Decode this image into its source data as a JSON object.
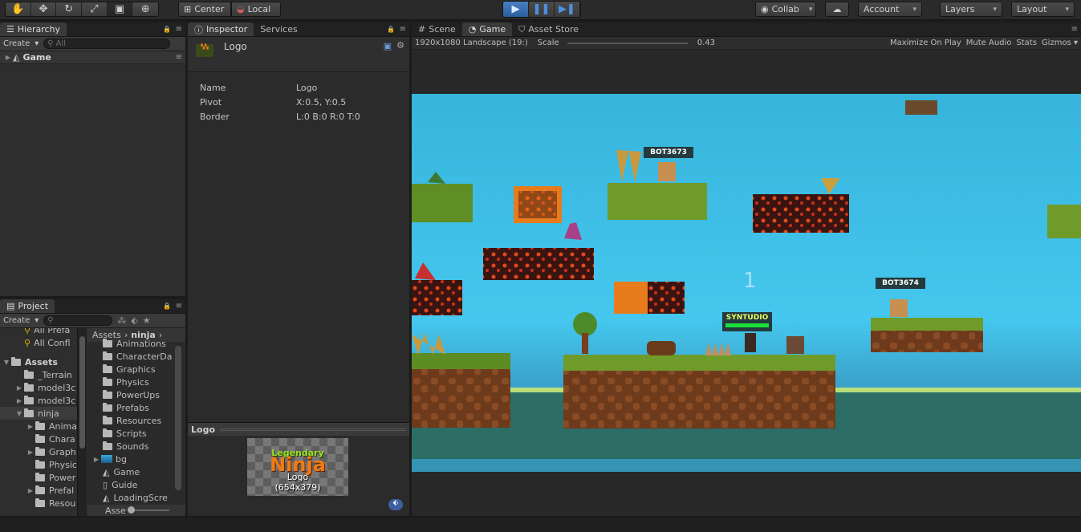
{
  "toolbar": {
    "tools": [
      "hand-tool-icon",
      "move-tool-icon",
      "rotate-tool-icon",
      "scale-tool-icon",
      "rect-tool-icon",
      "transform-tool-icon"
    ],
    "pivot_label": "Center",
    "space_label": "Local",
    "collab_label": "Collab",
    "account_label": "Account",
    "layers_label": "Layers",
    "layout_label": "Layout"
  },
  "hierarchy": {
    "tab": "Hierarchy",
    "create": "Create",
    "search_placeholder": "All",
    "scene_name": "Game"
  },
  "project": {
    "tab": "Project",
    "create": "Create",
    "favorites": [
      "All Prefa",
      "All Confl"
    ],
    "tree_root": "Assets",
    "tree": [
      "_Terrain",
      "model3c",
      "model3c",
      "ninja",
      "Anima",
      "Chara",
      "Graph",
      "Physic",
      "Power",
      "Prefal",
      "Resou"
    ],
    "breadcrumb": [
      "Assets",
      "ninja"
    ],
    "folders": [
      "Animations",
      "CharacterDa",
      "Graphics",
      "Physics",
      "PowerUps",
      "Prefabs",
      "Resources",
      "Scripts",
      "Sounds"
    ],
    "files": [
      "bg",
      "Game",
      "Guide",
      "LoadingScre"
    ],
    "bottom_label": "Asse"
  },
  "inspector": {
    "tab": "Inspector",
    "tab2": "Services",
    "object_name": "Logo",
    "fields": [
      {
        "key": "Name",
        "value": "Logo"
      },
      {
        "key": "Pivot",
        "value": "X:0.5, Y:0.5"
      },
      {
        "key": "Border",
        "value": "L:0 B:0 R:0 T:0"
      }
    ],
    "preview_title": "Logo",
    "preview_line1": "Legendary",
    "preview_line2": "Ninja",
    "preview_name": "Logo",
    "preview_size": "(654x379)"
  },
  "game": {
    "tabs": [
      "Scene",
      "Game",
      "Asset Store"
    ],
    "resolution": "1920x1080 Landscape (19:",
    "scale_label": "Scale",
    "scale_value": "0.43",
    "maximize": "Maximize On Play",
    "mute": "Mute Audio",
    "stats": "Stats",
    "gizmos": "Gizmos",
    "players": [
      "BOT3673",
      "BOT3674",
      "SYNTUDIO"
    ],
    "counter": "1"
  }
}
